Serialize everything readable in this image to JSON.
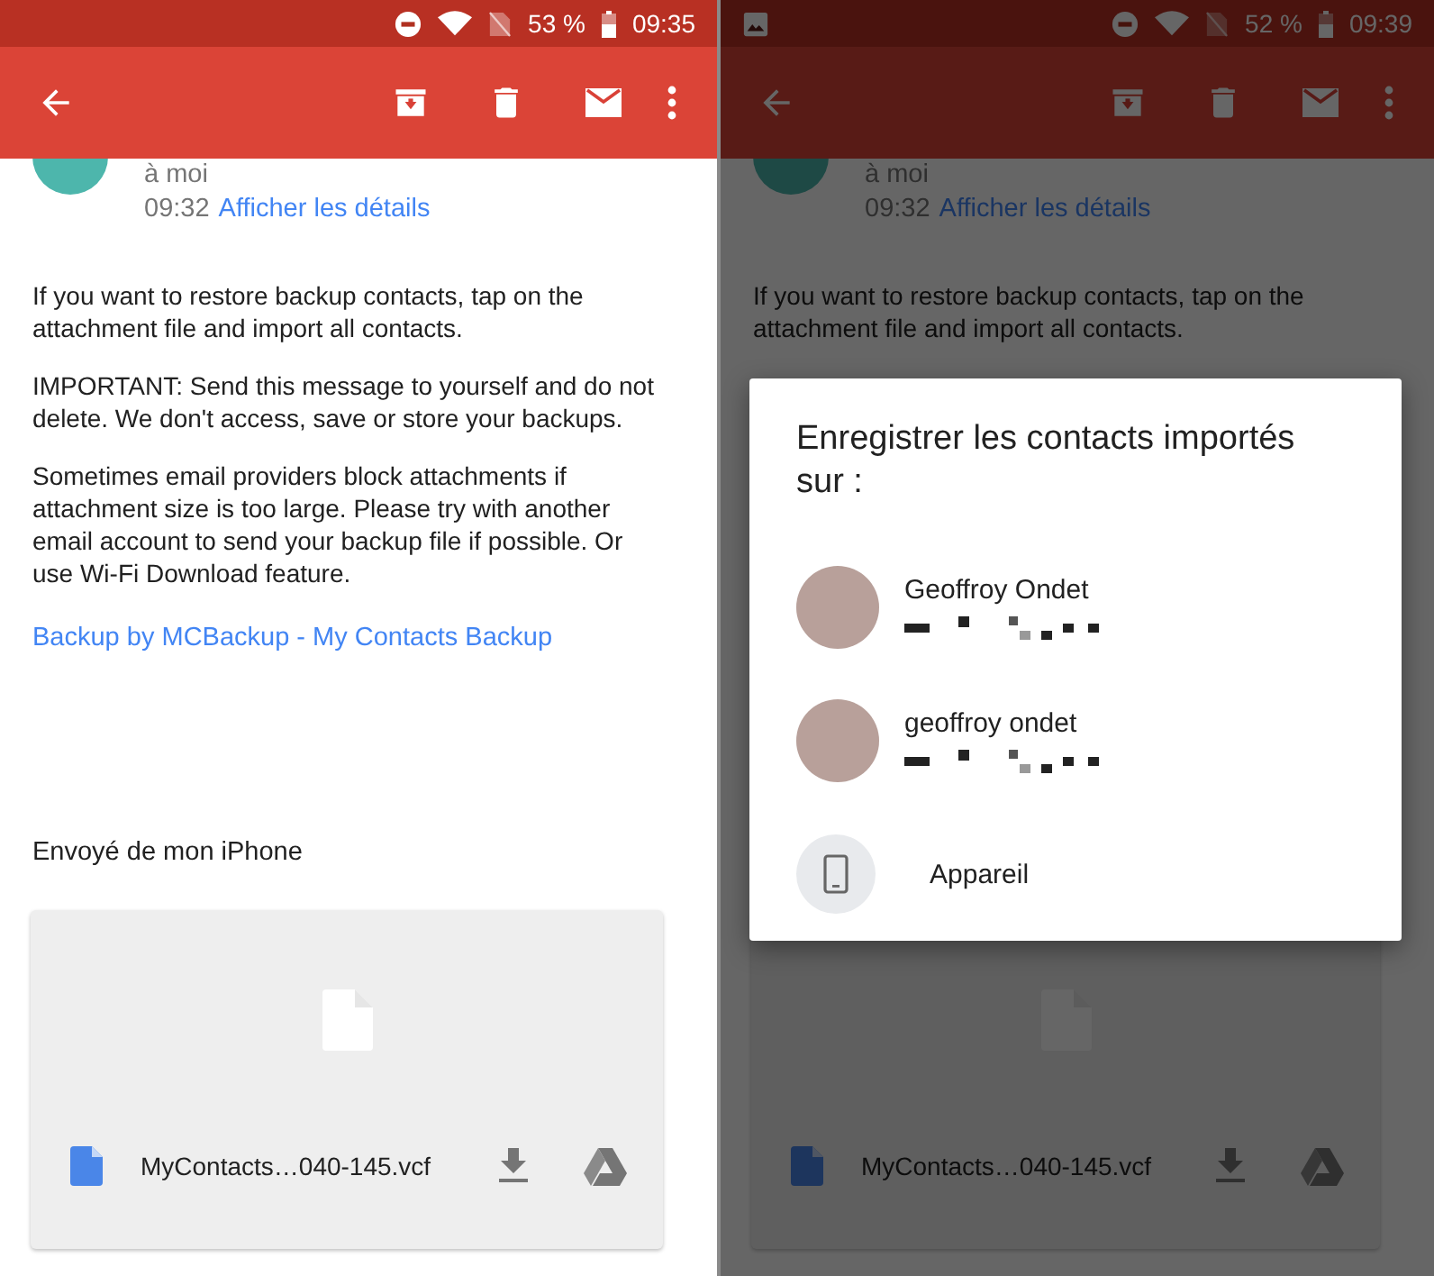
{
  "panels": [
    {
      "status_bar": {
        "image_notification": false,
        "battery": "53 %",
        "time": "09:35"
      },
      "email": {
        "recipient": "à moi",
        "time": "09:32",
        "details_link": "Afficher les détails",
        "paragraphs": [
          "If you want to restore backup contacts, tap on the attachment file and import all contacts.",
          "IMPORTANT: Send this message to yourself and do not delete. We don't access, save or store your backups.",
          "Sometimes email providers block attachments if attachment size is too large. Please try with another email account to send your backup file if possible. Or use Wi-Fi Download feature."
        ],
        "signature_link": "Backup by MCBackup - My Contacts Backup",
        "sent_from": "Envoyé de mon iPhone",
        "attachment": {
          "filename": "MyContacts…040-145.vcf"
        }
      },
      "dimmed": false
    },
    {
      "status_bar": {
        "image_notification": true,
        "battery": "52 %",
        "time": "09:39"
      },
      "email": {
        "recipient": "à moi",
        "time": "09:32",
        "details_link": "Afficher les détails",
        "paragraphs": [
          "If you want to restore backup contacts, tap on the attachment file and import all contacts."
        ],
        "attachment": {
          "filename": "MyContacts…040-145.vcf"
        }
      },
      "dimmed": true,
      "dialog": {
        "title": "Enregistrer les contacts importés sur :",
        "options": [
          {
            "kind": "account",
            "name": "Geoffroy Ondet"
          },
          {
            "kind": "account",
            "name": "geoffroy ondet"
          },
          {
            "kind": "device",
            "name": "Appareil"
          }
        ]
      }
    }
  ]
}
